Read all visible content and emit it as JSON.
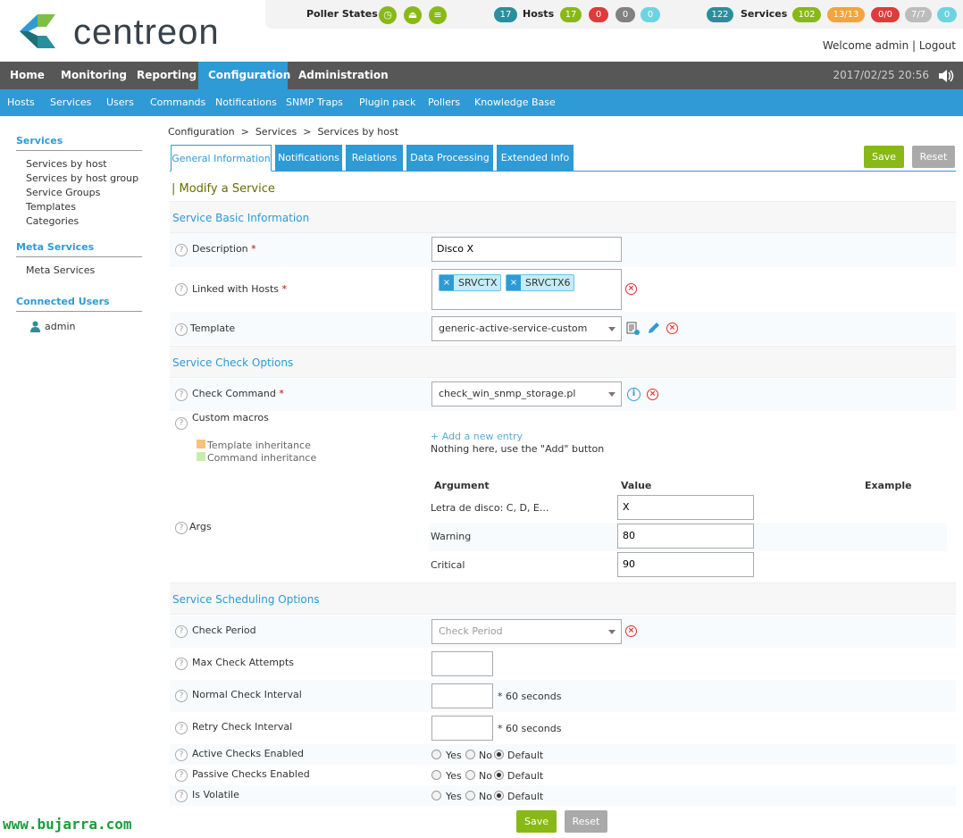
{
  "logo": {
    "text": "centreon"
  },
  "status": {
    "poller_label": "Poller States",
    "hosts_count": "17",
    "hosts_label": "Hosts",
    "hosts_up": "17",
    "hosts_down": "0",
    "hosts_unreach": "0",
    "hosts_pending": "0",
    "services_count": "122",
    "services_label": "Services",
    "svc_ok": "102",
    "svc_warn": "13/13",
    "svc_crit": "0/0",
    "svc_unknown": "7/7",
    "svc_pending": "0"
  },
  "user": {
    "welcome": "Welcome admin",
    "separator": "|",
    "logout": "Logout"
  },
  "mainnav": {
    "items": [
      "Home",
      "Monitoring",
      "Reporting",
      "Configuration",
      "Administration"
    ],
    "datetime": "2017/02/25 20:56"
  },
  "subnav": {
    "items": [
      "Hosts",
      "Services",
      "Users",
      "Commands",
      "Notifications",
      "SNMP Traps",
      "Plugin pack",
      "Pollers",
      "Knowledge Base"
    ]
  },
  "sidebar": {
    "services_header": "Services",
    "services_items": [
      "Services by host",
      "Services by host group",
      "Service Groups",
      "Templates",
      "Categories"
    ],
    "meta_header": "Meta Services",
    "meta_items": [
      "Meta Services"
    ],
    "users_header": "Connected Users",
    "users_items": [
      "admin"
    ]
  },
  "breadcrumb": {
    "a": "Configuration",
    "b": "Services",
    "c": "Services by host",
    "sep": ">"
  },
  "tabs": [
    "General Information",
    "Notifications",
    "Relations",
    "Data Processing",
    "Extended Info"
  ],
  "buttons": {
    "save": "Save",
    "reset": "Reset"
  },
  "page_title": "| Modify a Service",
  "sections": {
    "basic": "Service Basic Information",
    "check": "Service Check Options",
    "sched": "Service Scheduling Options"
  },
  "fields": {
    "description_label": "Description",
    "description_value": "Disco X",
    "hosts_label": "Linked with Hosts",
    "hosts": [
      "SRVCTX",
      "SRVCTX6"
    ],
    "template_label": "Template",
    "template_value": "generic-active-service-custom",
    "command_label": "Check Command",
    "command_value": "check_win_snmp_storage.pl",
    "macros_label": "Custom macros",
    "add_entry": "+ Add a new entry",
    "nothing_here": "Nothing here, use the \"Add\" button",
    "legend_template": "Template inheritance",
    "legend_command": "Command inheritance",
    "args_label": "Args",
    "args_headers": {
      "argument": "Argument",
      "value": "Value",
      "example": "Example"
    },
    "args": [
      {
        "name": "Letra de disco: C, D, E...",
        "value": "X"
      },
      {
        "name": "Warning",
        "value": "80"
      },
      {
        "name": "Critical",
        "value": "90"
      }
    ],
    "period_label": "Check Period",
    "period_placeholder": "Check Period",
    "max_attempts_label": "Max Check Attempts",
    "normal_interval_label": "Normal Check Interval",
    "retry_interval_label": "Retry Check Interval",
    "seconds_suffix": "* 60 seconds",
    "active_label": "Active Checks Enabled",
    "passive_label": "Passive Checks Enabled",
    "volatile_label": "Is Volatile",
    "radio": {
      "yes": "Yes",
      "no": "No",
      "default": "Default"
    }
  },
  "footer": "www.bujarra.com"
}
